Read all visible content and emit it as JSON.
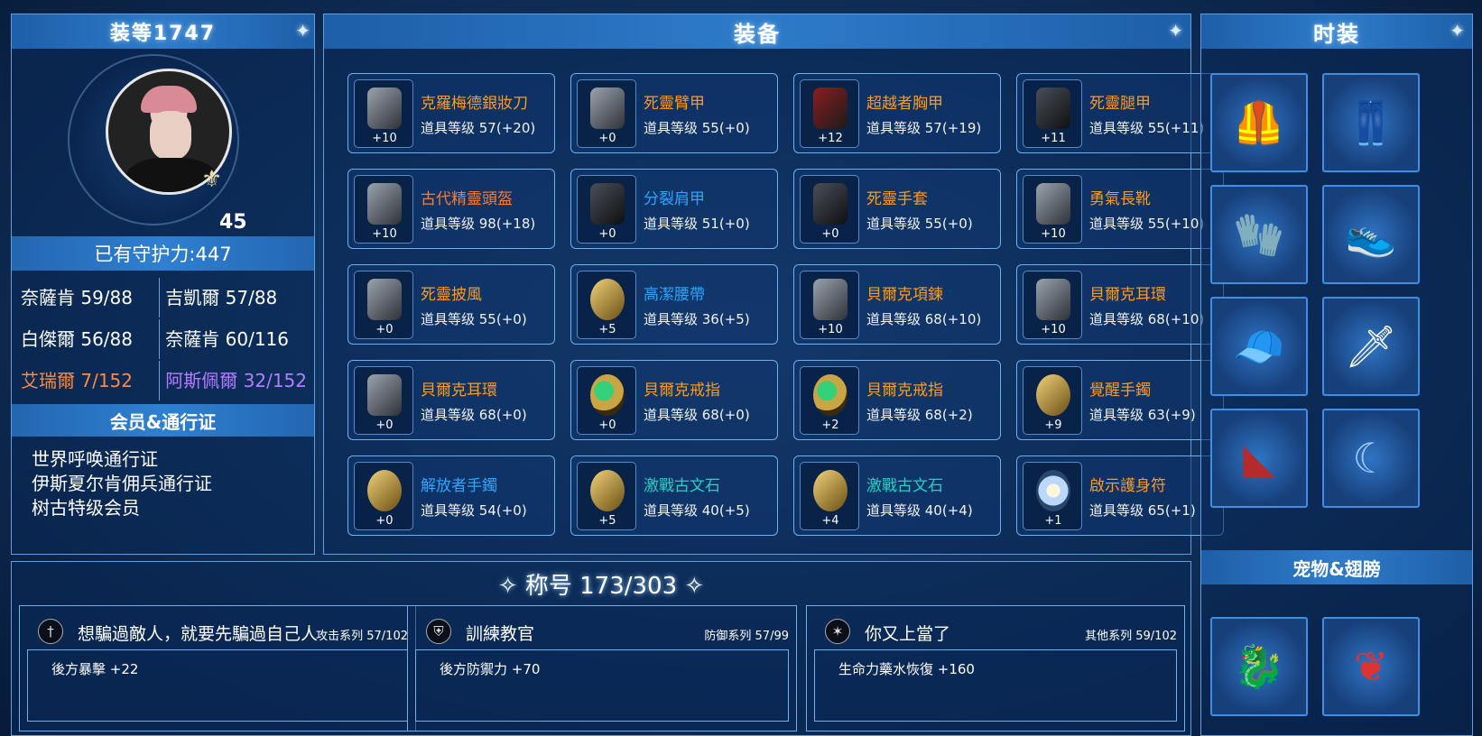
{
  "colors": {
    "orange": "#ff9a1f",
    "blue": "#2aa6ff",
    "teal": "#25d0c4",
    "skill_orange": "#ff8a3a",
    "skill_purple": "#b67cff"
  },
  "left": {
    "header": "装等1747",
    "level": "45",
    "defense_bar": "已有守护力:447",
    "skills": [
      {
        "label": "奈薩肯 59/88",
        "color": "white"
      },
      {
        "label": "吉凱爾 57/88",
        "color": "white"
      },
      {
        "label": "白傑爾 56/88",
        "color": "white"
      },
      {
        "label": "奈薩肯 60/116",
        "color": "white"
      },
      {
        "label": "艾瑞爾 7/152",
        "color": "orange"
      },
      {
        "label": "阿斯佩爾 32/152",
        "color": "purple"
      }
    ],
    "membership_bar": "会员&通行证",
    "passes": [
      "世界呼唤通行证",
      "伊斯夏尔肯佣兵通行证",
      "树古特级会员"
    ]
  },
  "equipment": {
    "title": "装备",
    "slots": [
      {
        "name": "克羅梅德銀妝刀",
        "level": "道具等级 57(+20)",
        "plus": "+10",
        "color": "#ff9a1f",
        "icon": "dagger-icon"
      },
      {
        "name": "死靈臂甲",
        "level": "道具等级 55(+0)",
        "plus": "+0",
        "color": "#ff9a1f",
        "icon": "armguard-icon"
      },
      {
        "name": "超越者胸甲",
        "level": "道具等级 57(+19)",
        "plus": "+12",
        "color": "#ff9a1f",
        "icon": "chest-armor-icon"
      },
      {
        "name": "死靈腿甲",
        "level": "道具等级 55(+11)",
        "plus": "+11",
        "color": "#ff9a1f",
        "icon": "leg-armor-icon"
      },
      {
        "name": "古代精靈頭盔",
        "level": "道具等级 98(+18)",
        "plus": "+10",
        "color": "#ff7a2a",
        "icon": "helmet-icon"
      },
      {
        "name": "分裂肩甲",
        "level": "道具等级 51(+0)",
        "plus": "+0",
        "color": "#2aa6ff",
        "icon": "shoulder-icon"
      },
      {
        "name": "死靈手套",
        "level": "道具等级 55(+0)",
        "plus": "+0",
        "color": "#ff9a1f",
        "icon": "gloves-icon"
      },
      {
        "name": "勇氣長靴",
        "level": "道具等级 55(+10)",
        "plus": "+10",
        "color": "#ff9a1f",
        "icon": "boots-icon"
      },
      {
        "name": "死靈披風",
        "level": "道具等级 55(+0)",
        "plus": "+0",
        "color": "#ff9a1f",
        "icon": "cape-icon"
      },
      {
        "name": "高潔腰帶",
        "level": "道具等级 36(+5)",
        "plus": "+5",
        "color": "#2aa6ff",
        "icon": "belt-icon"
      },
      {
        "name": "貝爾克項鍊",
        "level": "道具等级 68(+10)",
        "plus": "+10",
        "color": "#ff9a1f",
        "icon": "necklace-icon"
      },
      {
        "name": "貝爾克耳環",
        "level": "道具等级 68(+10)",
        "plus": "+10",
        "color": "#ff9a1f",
        "icon": "earring-icon"
      },
      {
        "name": "貝爾克耳環",
        "level": "道具等级 68(+0)",
        "plus": "+0",
        "color": "#ff9a1f",
        "icon": "earring-icon"
      },
      {
        "name": "貝爾克戒指",
        "level": "道具等级 68(+0)",
        "plus": "+0",
        "color": "#ff9a1f",
        "icon": "ring-icon"
      },
      {
        "name": "貝爾克戒指",
        "level": "道具等级 68(+2)",
        "plus": "+2",
        "color": "#ff9a1f",
        "icon": "ring-icon"
      },
      {
        "name": "覺醒手鐲",
        "level": "道具等级 63(+9)",
        "plus": "+9",
        "color": "#ff9a1f",
        "icon": "bracelet-icon"
      },
      {
        "name": "解放者手鐲",
        "level": "道具等级 54(+0)",
        "plus": "+0",
        "color": "#2aa6ff",
        "icon": "bracelet-icon"
      },
      {
        "name": "激戰古文石",
        "level": "道具等级 40(+5)",
        "plus": "+5",
        "color": "#25d0c4",
        "icon": "runestone-icon"
      },
      {
        "name": "激戰古文石",
        "level": "道具等级 40(+4)",
        "plus": "+4",
        "color": "#25d0c4",
        "icon": "runestone-icon"
      },
      {
        "name": "啟示護身符",
        "level": "道具等级 65(+1)",
        "plus": "+1",
        "color": "#ff9a1f",
        "icon": "amulet-icon"
      }
    ]
  },
  "fashion": {
    "title": "时装",
    "items": [
      "vest-icon",
      "pants-icon",
      "glove-icon",
      "shoes-icon",
      "cap-icon",
      "weapon-icon",
      "cape-icon",
      "earring-icon"
    ],
    "pets_title": "宠物&翅膀",
    "pets": [
      "dragon-pet-icon",
      "wings-icon"
    ]
  },
  "titles": {
    "header": "称号 173/303",
    "cards": [
      {
        "icon": "sword-icon",
        "name": "想騙過敵人，就要先騙過自己人",
        "series": "攻击系列 57/102",
        "effect": "後方暴擊 +22"
      },
      {
        "icon": "shield-icon",
        "name": "訓練教官",
        "series": "防御系列 57/99",
        "effect": "後方防禦力 +70"
      },
      {
        "icon": "star-icon",
        "name": "你又上當了",
        "series": "其他系列 59/102",
        "effect": "生命力藥水恢復 +160"
      }
    ]
  }
}
